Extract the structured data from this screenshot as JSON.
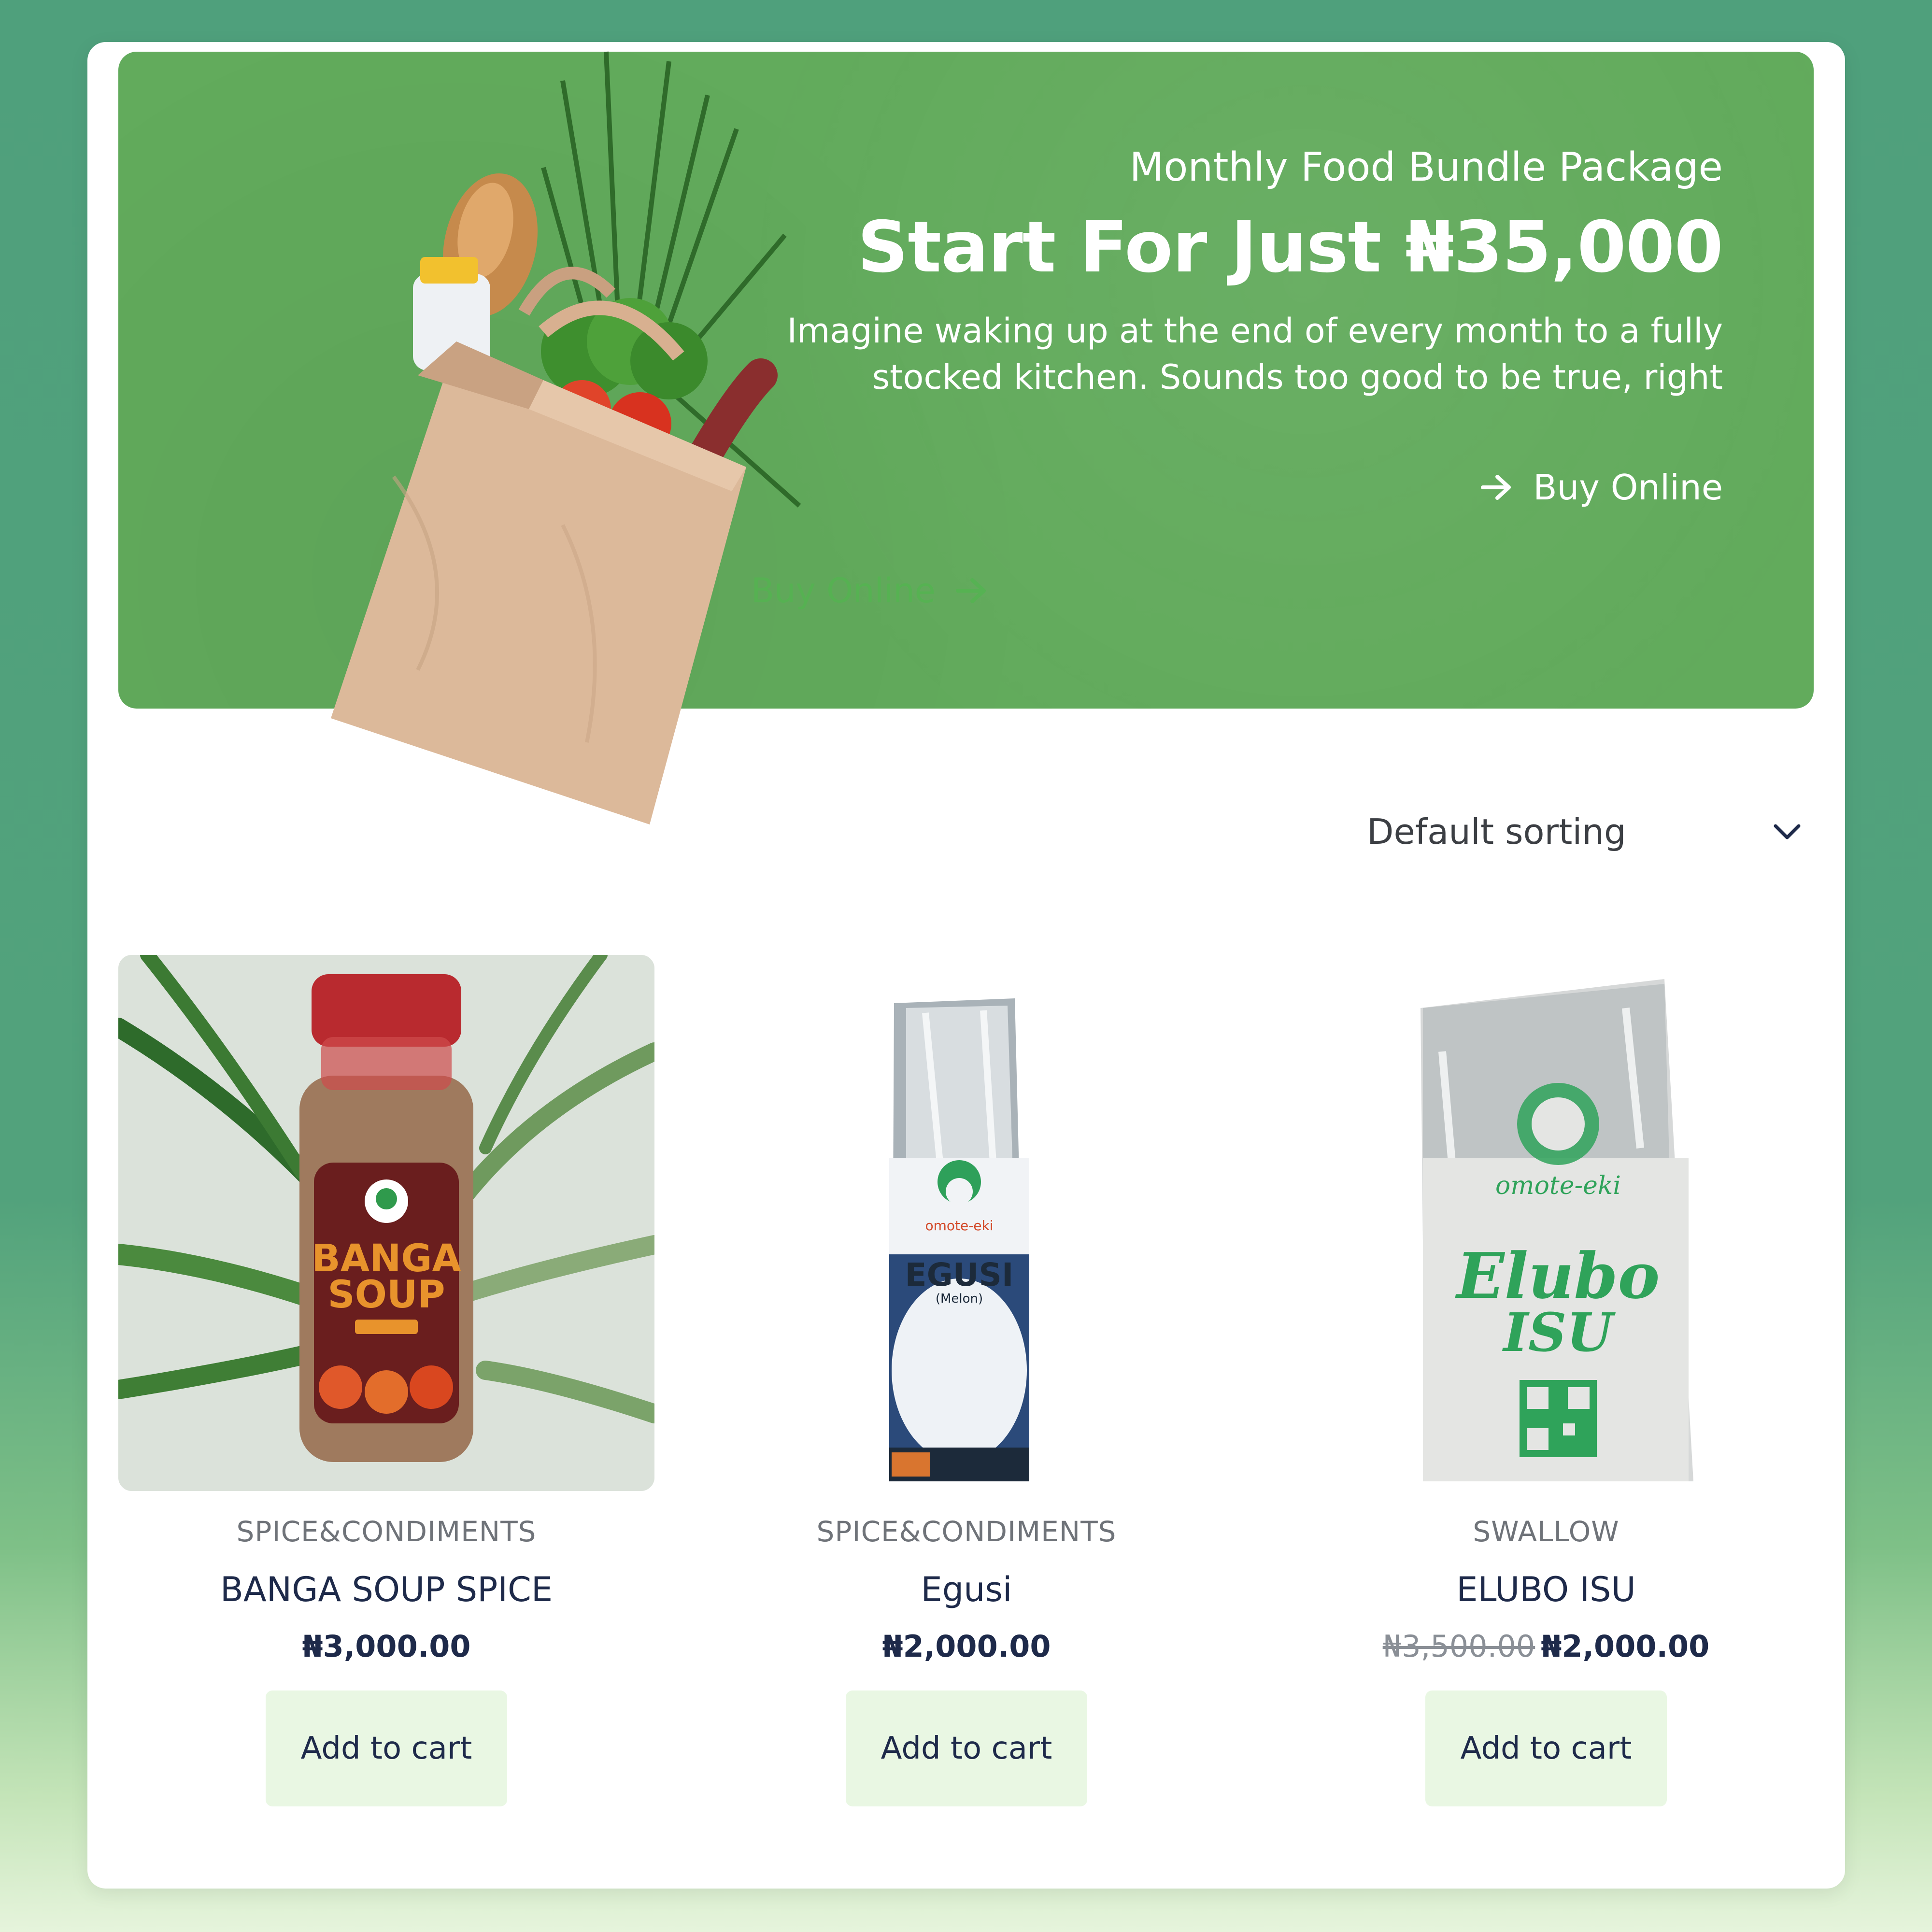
{
  "hero": {
    "eyebrow": "Monthly Food Bundle Package",
    "title": "Start For Just ₦35,000",
    "description": "Imagine waking up at the end of every month to a fully stocked kitchen. Sounds too good to be true, right",
    "cta_label": "Buy Online",
    "ghost_cta_label": "Buy Online",
    "image_icon": "grocery-bag-illustration"
  },
  "sorting": {
    "selected": "Default sorting"
  },
  "products": [
    {
      "category": "SPICE&CONDIMENTS",
      "name": "BANGA SOUP SPICE",
      "price": "₦3,000.00",
      "button": "Add to cart",
      "label_line1": "BANGA",
      "label_line2": "SOUP"
    },
    {
      "category": "SPICE&CONDIMENTS",
      "name": "Egusi",
      "price": "₦2,000.00",
      "button": "Add to cart",
      "pack_brand": "omote-eki",
      "pack_title": "EGUSI",
      "pack_subtitle": "(Melon)"
    },
    {
      "category": "SWALLOW",
      "name": "ELUBO ISU",
      "old_price": "₦3,500.00",
      "price": "₦2,000.00",
      "button": "Add to cart",
      "pack_brand": "omote-eki",
      "pack_title1": "Elubo",
      "pack_title2": "ISU"
    }
  ],
  "colors": {
    "hero_green": "#62ab5c",
    "button_bg": "#e9f7e3",
    "text_dark": "#1e2a4a",
    "brand_green": "#2fa35a"
  }
}
